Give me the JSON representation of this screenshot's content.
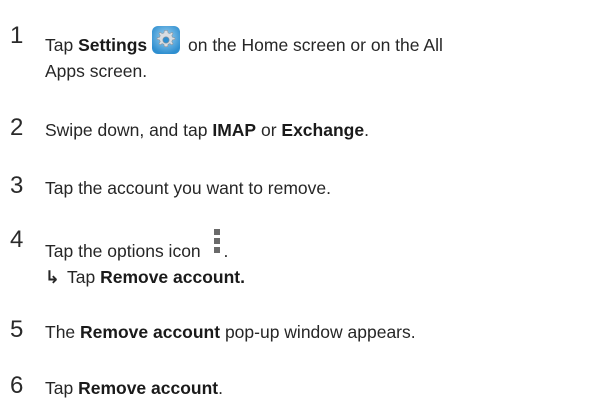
{
  "steps": [
    {
      "number": "1",
      "pre": "Tap ",
      "bold": "Settings",
      "icon": "settings-gear-icon",
      "post": " on the Home screen or on the All",
      "line2": "Apps screen."
    },
    {
      "number": "2",
      "pre": "Swipe down, and tap ",
      "bold1": "IMAP",
      "mid": " or ",
      "bold2": "Exchange",
      "post": "."
    },
    {
      "number": "3",
      "text": "Tap the account you want to remove."
    },
    {
      "number": "4",
      "pre": "Tap the options icon ",
      "icon": "options-vertical-dots-icon",
      "post": ".",
      "result_arrow": "↳",
      "result_pre": "Tap ",
      "result_bold": "Remove account."
    },
    {
      "number": "5",
      "pre": "The ",
      "bold": "Remove account",
      "post": " pop-up window appears."
    },
    {
      "number": "6",
      "pre": "Tap ",
      "bold": "Remove account",
      "post": "."
    }
  ]
}
